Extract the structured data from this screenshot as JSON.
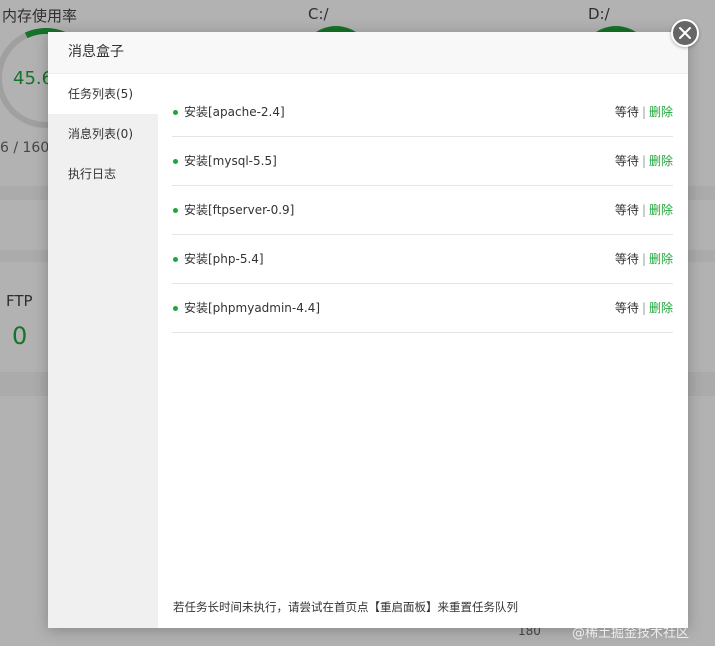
{
  "background": {
    "memory_label": "内存使用率",
    "memory_value": "45.6",
    "memory_sub": "6 / 160",
    "disk_c_label": "C:/",
    "disk_d_label": "D:/",
    "ftp_label": "FTP",
    "ftp_value": "0",
    "axis_tick": "180",
    "accent": "#20a53a"
  },
  "modal": {
    "title": "消息盒子",
    "close_icon": "close-icon",
    "sidebar": [
      {
        "label": "任务列表(5)",
        "active": true
      },
      {
        "label": "消息列表(0)",
        "active": false
      },
      {
        "label": "执行日志",
        "active": false
      }
    ],
    "tasks": [
      {
        "name": "安装[apache-2.4]",
        "status": "等待",
        "sep": "|",
        "action": "删除"
      },
      {
        "name": "安装[mysql-5.5]",
        "status": "等待",
        "sep": "|",
        "action": "删除"
      },
      {
        "name": "安装[ftpserver-0.9]",
        "status": "等待",
        "sep": "|",
        "action": "删除"
      },
      {
        "name": "安装[php-5.4]",
        "status": "等待",
        "sep": "|",
        "action": "删除"
      },
      {
        "name": "安装[phpmyadmin-4.4]",
        "status": "等待",
        "sep": "|",
        "action": "删除"
      }
    ],
    "hint": "若任务长时间未执行，请尝试在首页点【重启面板】来重置任务队列"
  },
  "watermark": "@稀土掘金技术社区"
}
